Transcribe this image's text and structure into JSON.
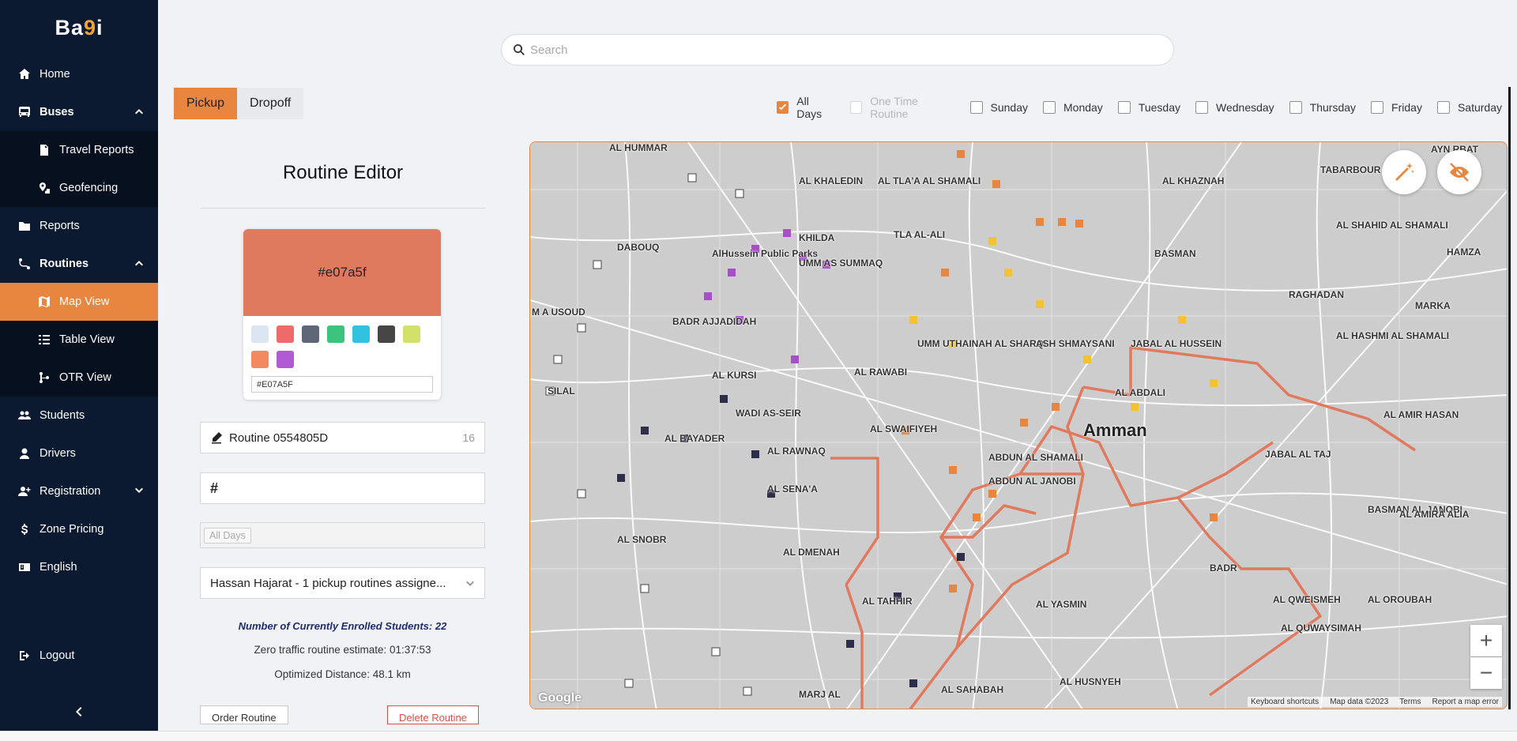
{
  "sidebar": {
    "logo_main": "Ba",
    "logo_dot": "9",
    "logo_end": "i",
    "items": [
      {
        "label": "Home",
        "icon": "home-icon"
      },
      {
        "label": "Buses",
        "icon": "bus-icon"
      },
      {
        "label": "Travel Reports",
        "icon": "file-icon"
      },
      {
        "label": "Geofencing",
        "icon": "geofence-icon"
      },
      {
        "label": "Reports",
        "icon": "folder-icon"
      },
      {
        "label": "Routines",
        "icon": "route-icon"
      },
      {
        "label": "Map View",
        "icon": "map-icon"
      },
      {
        "label": "Table View",
        "icon": "list-icon"
      },
      {
        "label": "OTR View",
        "icon": "branch-icon"
      },
      {
        "label": "Students",
        "icon": "users-icon"
      },
      {
        "label": "Drivers",
        "icon": "driver-icon"
      },
      {
        "label": "Registration",
        "icon": "user-plus-icon"
      },
      {
        "label": "Zone Pricing",
        "icon": "dollar-icon"
      },
      {
        "label": "English",
        "icon": "language-icon"
      }
    ],
    "logout": "Logout"
  },
  "search": {
    "placeholder": "Search"
  },
  "tabs": {
    "pickup": "Pickup",
    "dropoff": "Dropoff"
  },
  "days": [
    {
      "label": "All Days",
      "checked": true,
      "disabled": false
    },
    {
      "label": "One Time Routine",
      "checked": false,
      "disabled": true
    },
    {
      "label": "Sunday",
      "checked": false,
      "disabled": false
    },
    {
      "label": "Monday",
      "checked": false,
      "disabled": false
    },
    {
      "label": "Tuesday",
      "checked": false,
      "disabled": false
    },
    {
      "label": "Wednesday",
      "checked": false,
      "disabled": false
    },
    {
      "label": "Thursday",
      "checked": false,
      "disabled": false
    },
    {
      "label": "Friday",
      "checked": false,
      "disabled": false
    },
    {
      "label": "Saturday",
      "checked": false,
      "disabled": false
    }
  ],
  "editor": {
    "title": "Routine Editor",
    "color_hex": "#e07a5f",
    "color_input": "#E07A5F",
    "swatches": [
      "#dce6f2",
      "#ef6b6b",
      "#5e6677",
      "#3cc47c",
      "#31c2e0",
      "#464646",
      "#d3e06a",
      "#f4895f",
      "#b25ad6"
    ],
    "routine_name": "Routine 0554805D",
    "routine_name_count": "16",
    "number_prefix": "#",
    "days_tag": "All Days",
    "driver_select": "Hassan Hajarat - 1 pickup routines assigne...",
    "enrolled": "Number of Currently Enrolled Students: 22",
    "estimate": "Zero traffic routine estimate: 01:37:53",
    "distance": "Optimized Distance: 48.1 km",
    "order_btn": "Order Routine",
    "delete_btn": "Delete Routine"
  },
  "map": {
    "labels": [
      {
        "text": "AL HUMMAR"
      },
      {
        "text": "AL KHALEDIN"
      },
      {
        "text": "AL TLA'A AL SHAMALI"
      },
      {
        "text": "AL KHAZNAH"
      },
      {
        "text": "TABARBOUR"
      },
      {
        "text": "AYN RBAT"
      },
      {
        "text": "DABOUQ"
      },
      {
        "text": "KHILDA"
      },
      {
        "text": "TLA AL-ALI"
      },
      {
        "text": "AlHussein Public Parks"
      },
      {
        "text": "BASMAN"
      },
      {
        "text": "AL SHAHID AL SHAMALI"
      },
      {
        "text": "HAMZA"
      },
      {
        "text": "UMM AS SUMMAQ"
      },
      {
        "text": "M A USOUD"
      },
      {
        "text": "RAGHADAN"
      },
      {
        "text": "MARKA"
      },
      {
        "text": "BADR AJJADIDAH"
      },
      {
        "text": "UMM UTHAINAH AL SHARQI"
      },
      {
        "text": "ASH SHMAYSANI"
      },
      {
        "text": "JABAL AL HUSSEIN"
      },
      {
        "text": "AL HASHMI AL SHAMALI"
      },
      {
        "text": "AL KURSI"
      },
      {
        "text": "AL RAWABI"
      },
      {
        "text": "AL ABDALI"
      },
      {
        "text": "WADI AS-SEIR"
      },
      {
        "text": "AL SWAIFIYEH"
      },
      {
        "text": "AL AMIR HASAN"
      },
      {
        "text": "AL BAYADER"
      },
      {
        "text": "Amman"
      },
      {
        "text": "JABAL AL TAJ"
      },
      {
        "text": "AL RAWNAQ"
      },
      {
        "text": "ABDUN AL SHAMALI"
      },
      {
        "text": "ABDUN AL JANOBI"
      },
      {
        "text": "AL SENA'A"
      },
      {
        "text": "BASMAN AL JANOBI"
      },
      {
        "text": "AL AMIRA ALIA"
      },
      {
        "text": "AL SNOBR"
      },
      {
        "text": "AL DMENAH"
      },
      {
        "text": "BADR"
      },
      {
        "text": "AL QWEISMEH"
      },
      {
        "text": "AL OROUBAH"
      },
      {
        "text": "AL TAHHIR"
      },
      {
        "text": "AL YASMIN"
      },
      {
        "text": "AL QUWAYSIMAH"
      },
      {
        "text": "MARJ AL"
      },
      {
        "text": "AL SAHABAH"
      },
      {
        "text": "AL HUSNYEH"
      },
      {
        "text": "SILAL"
      }
    ],
    "google": "Google",
    "attrib": [
      "Keyboard shortcuts",
      "Map data ©2023",
      "Terms",
      "Report a map error"
    ],
    "zoom_in": "+",
    "zoom_out": "−"
  },
  "colors": {
    "accent": "#e8863f",
    "sidebar": "#0b1a30",
    "route": "#e07a5f"
  }
}
